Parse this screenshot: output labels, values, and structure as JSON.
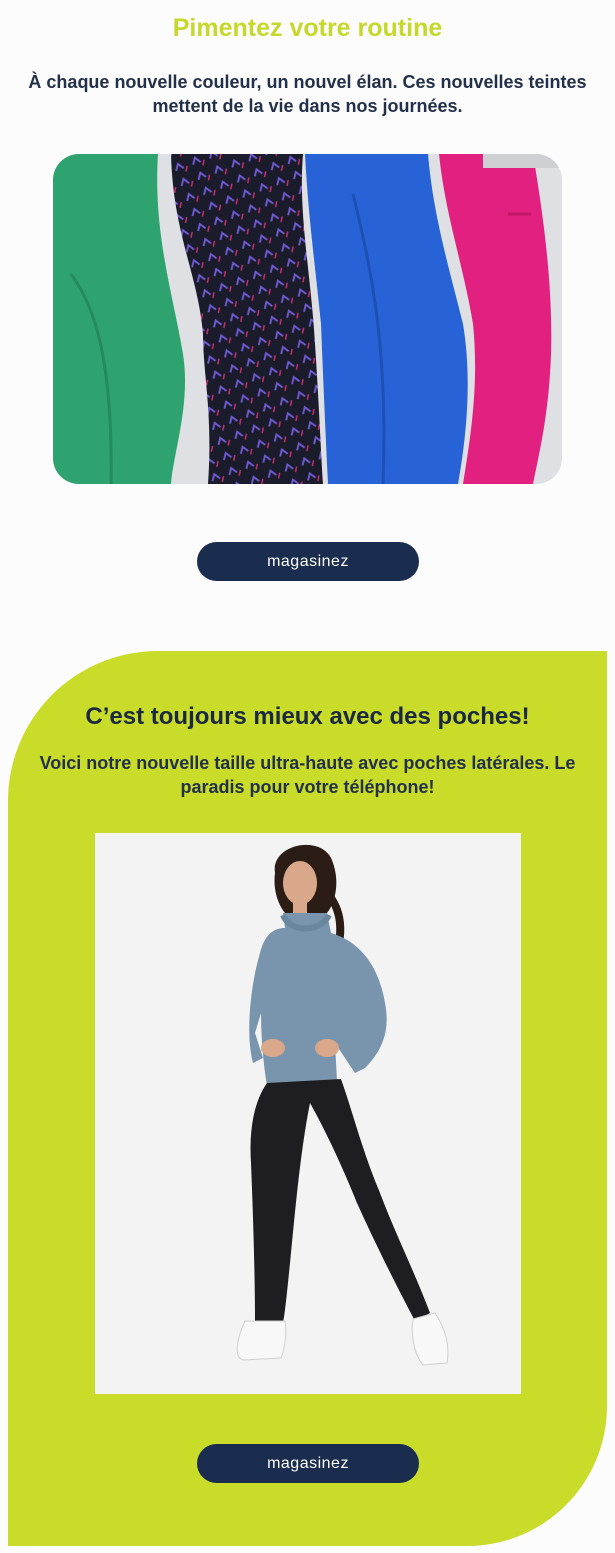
{
  "section1": {
    "title": "Pimentez votre routine",
    "subtitle": "À chaque nouvelle couleur, un nouvel élan. Ces nouvelles teintes mettent de la vie dans nos journées.",
    "image_alt": "Leggings verts, imprimés, bleus et roses",
    "button_label": "magasinez"
  },
  "section2": {
    "title": "C’est toujours mieux avec des poches!",
    "subtitle": "Voici notre nouvelle taille ultra-haute avec poches latérales. Le paradis pour votre téléphone!",
    "image_alt": "Femme en chandail bleu et leggings noirs",
    "button_label": "magasinez"
  },
  "colors": {
    "accent_lime": "#c8dc29",
    "navy": "#1b2d4f",
    "background": "#fdfcfd"
  }
}
